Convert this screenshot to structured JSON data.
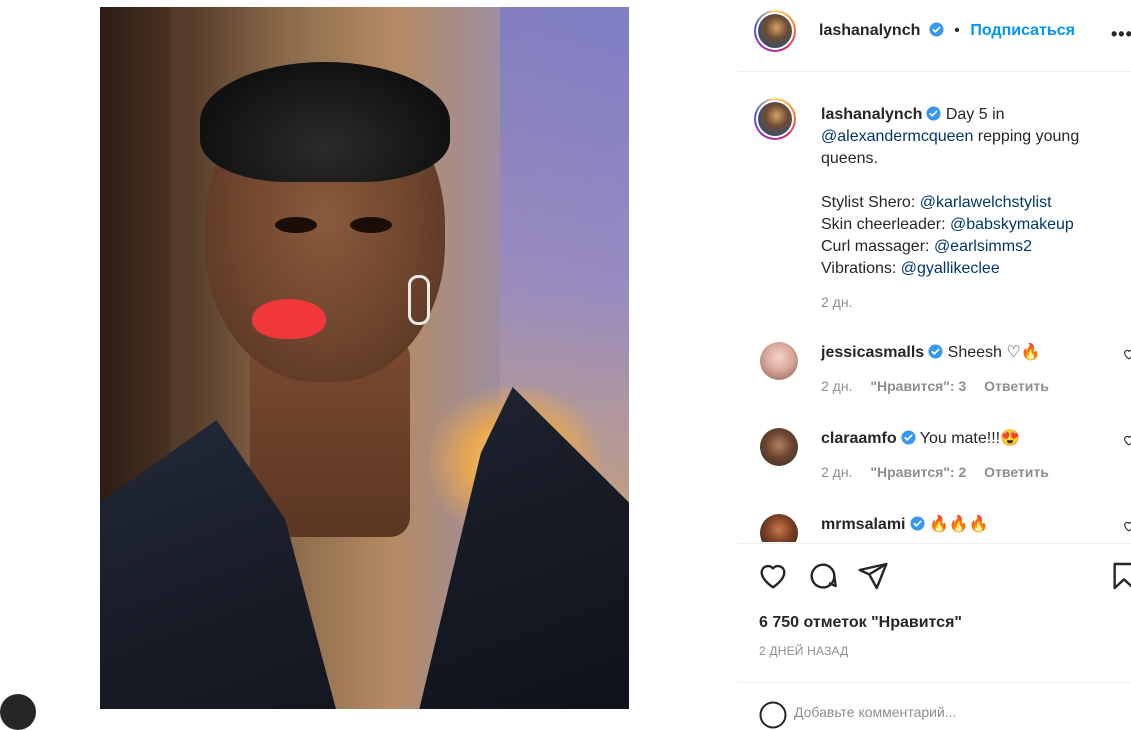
{
  "post": {
    "author": "lashanalynch",
    "follow_label": "Подписаться",
    "separator": "•",
    "more_label": "•••"
  },
  "caption": {
    "author": "lashanalynch",
    "text_pre": "Day 5 in",
    "mention_brand": "@alexandermcqueen",
    "text_post": "repping young queens.",
    "lines": [
      {
        "label": "Stylist Shero:",
        "mention": "@karlawelchstylist"
      },
      {
        "label": "Skin cheerleader:",
        "mention": "@babskymakeup"
      },
      {
        "label": "Curl massager:",
        "mention": "@earlsimms2"
      },
      {
        "label": "Vibrations:",
        "mention": "@gyallikeclee"
      }
    ],
    "time": "2 дн."
  },
  "comments": [
    {
      "user": "jessicasmalls",
      "text": "Sheesh ♡🔥",
      "time": "2 дн.",
      "likes": "\"Нравится\": 3",
      "reply": "Ответить"
    },
    {
      "user": "claraamfo",
      "text": "You mate!!!😍",
      "time": "2 дн.",
      "likes": "\"Нравится\": 2",
      "reply": "Ответить"
    },
    {
      "user": "mrmsalami",
      "text": "🔥🔥🔥"
    }
  ],
  "actions": {
    "likes_count": "6 750 отметок \"Нравится\"",
    "date_ago": "2 ДНЕЙ НАЗАД",
    "add_comment_placeholder": "Добавьте комментарий..."
  },
  "colors": {
    "accent": "#0095f6",
    "link": "#00376b",
    "text": "#262626",
    "muted": "#8e8e8e",
    "verified": "#3897f0"
  },
  "icons": [
    "verified-badge-icon",
    "more-options-icon",
    "heart-icon",
    "comment-icon",
    "share-icon",
    "bookmark-icon",
    "emoji-icon"
  ]
}
